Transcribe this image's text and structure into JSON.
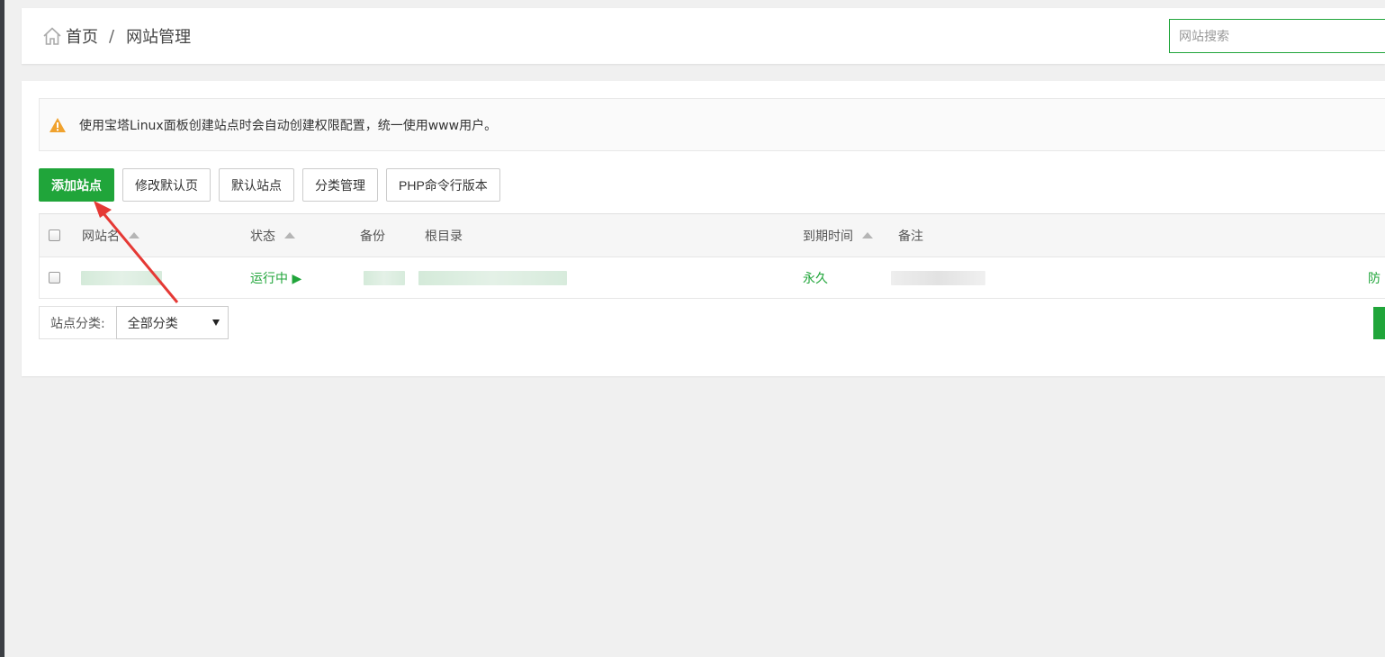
{
  "breadcrumb": {
    "home": "首页",
    "separator": "/",
    "current": "网站管理"
  },
  "search": {
    "placeholder": "网站搜索",
    "value": ""
  },
  "alert": {
    "icon": "warning-icon",
    "text": "使用宝塔Linux面板创建站点时会自动创建权限配置，统一使用www用户。"
  },
  "toolbar": {
    "add_site": "添加站点",
    "edit_default_page": "修改默认页",
    "default_site": "默认站点",
    "category_manage": "分类管理",
    "php_cli_version": "PHP命令行版本"
  },
  "table": {
    "columns": {
      "site_name": "网站名",
      "status": "状态",
      "backup": "备份",
      "root_dir": "根目录",
      "expire": "到期时间",
      "remark": "备注"
    },
    "rows": [
      {
        "site_name": "",
        "status": "运行中 ▶",
        "backup": "",
        "root_dir": "",
        "expire": "永久",
        "remark": "",
        "action_partial": "防"
      }
    ]
  },
  "category": {
    "label": "站点分类:",
    "selected": "全部分类"
  },
  "colors": {
    "accent": "#20a53a",
    "warning": "#f0a22e",
    "annotation": "#e53935"
  }
}
